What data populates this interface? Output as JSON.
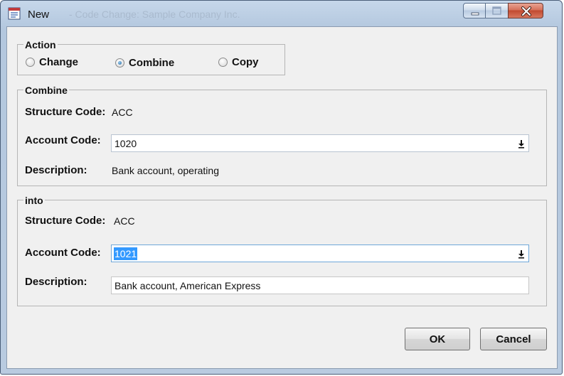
{
  "window": {
    "title": "New",
    "ghost_title": "- Code Change: Sample Company Inc."
  },
  "action": {
    "legend": "Action",
    "options": [
      {
        "label": "Change",
        "selected": false
      },
      {
        "label": "Combine",
        "selected": true
      },
      {
        "label": "Copy",
        "selected": false
      }
    ]
  },
  "combine": {
    "legend": "Combine",
    "structure_code_label": "Structure Code:",
    "structure_code_value": "ACC",
    "account_code_label": "Account Code:",
    "account_code_value": "1020",
    "description_label": "Description:",
    "description_value": "Bank account, operating"
  },
  "into": {
    "legend": "into",
    "structure_code_label": "Structure Code:",
    "structure_code_value": "ACC",
    "account_code_label": "Account Code:",
    "account_code_value": "1021",
    "description_label": "Description:",
    "description_value": "Bank account, American Express"
  },
  "buttons": {
    "ok": "OK",
    "cancel": "Cancel"
  },
  "colors": {
    "frame": "#b9cbe0",
    "client": "#f0f0f0",
    "selection": "#3399ff",
    "close_button": "#c14a30"
  },
  "icons": [
    "app-icon",
    "minimize-icon",
    "maximize-icon",
    "close-icon",
    "dropdown-arrow-icon",
    "radio-icon"
  ]
}
